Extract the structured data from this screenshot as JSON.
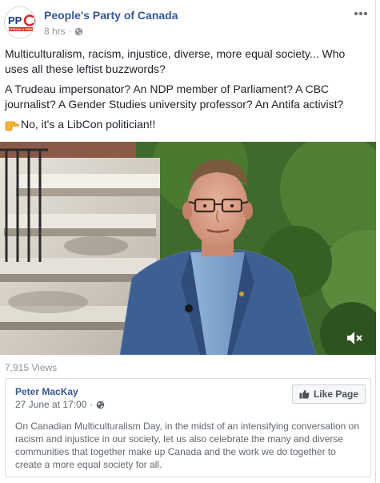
{
  "header": {
    "page_name": "People's Party of Canada",
    "timestamp": "8 hrs",
    "separator": "·",
    "avatar_text": "PPC",
    "avatar_subtext": "STRONG & FREE"
  },
  "post": {
    "paragraph_1": "Multiculturalism, racism, injustice, diverse, more equal society... Who uses all these leftist buzzwords?",
    "paragraph_2": "A Trudeau impersonator? An NDP member of Parliament? A CBC journalist? A Gender Studies university professor? An Antifa activist?",
    "paragraph_3": "No, it's a LibCon politician!!"
  },
  "video": {
    "views": "7,915 Views"
  },
  "shared": {
    "name": "Peter MacKay",
    "date": "27 June at 17:00",
    "separator": "·",
    "like_button_label": "Like Page",
    "text": "On Canadian Multiculturalism Day, in the midst of an intensifying conversation on racism and injustice in our society, let us also celebrate the many and diverse communities that together make up Canada and the work we do together to create a more equal society for all."
  },
  "icons": {
    "more": "more-horizontal-icon",
    "globe": "globe-icon",
    "point": "pointing-right-icon",
    "mute": "speaker-muted-icon",
    "thumb": "thumbs-up-icon"
  },
  "colors": {
    "link": "#365899",
    "meta": "#90949c",
    "ppc_red": "#d52b1e",
    "ppc_blue": "#1e3a8a"
  }
}
